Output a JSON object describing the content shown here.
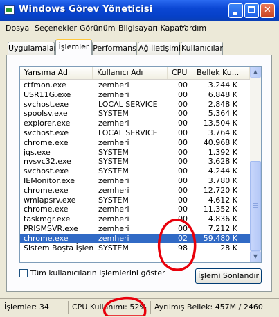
{
  "window": {
    "title": "Windows Görev Yöneticisi"
  },
  "menu": [
    "Dosya",
    "Seçenekler",
    "Görünüm",
    "Bilgisayarı Kapat",
    "Yardım"
  ],
  "tabs": [
    "Uygulamalar",
    "İşlemler",
    "Performans",
    "Ağ İletişimi",
    "Kullanıcılar"
  ],
  "active_tab": "İşlemler",
  "columns": [
    "Yansıma Adı",
    "Kullanıcı Adı",
    "CPU",
    "Bellek Ku..."
  ],
  "processes": [
    {
      "name": "ctfmon.exe",
      "user": "zemheri",
      "cpu": "00",
      "mem": "3.244 K"
    },
    {
      "name": "USR11G.exe",
      "user": "zemheri",
      "cpu": "00",
      "mem": "6.848 K"
    },
    {
      "name": "svchost.exe",
      "user": "LOCAL SERVICE",
      "cpu": "00",
      "mem": "2.848 K"
    },
    {
      "name": "spoolsv.exe",
      "user": "SYSTEM",
      "cpu": "00",
      "mem": "5.364 K"
    },
    {
      "name": "explorer.exe",
      "user": "zemheri",
      "cpu": "00",
      "mem": "13.504 K"
    },
    {
      "name": "svchost.exe",
      "user": "LOCAL SERVICE",
      "cpu": "00",
      "mem": "3.764 K"
    },
    {
      "name": "chrome.exe",
      "user": "zemheri",
      "cpu": "00",
      "mem": "40.968 K"
    },
    {
      "name": "jqs.exe",
      "user": "SYSTEM",
      "cpu": "00",
      "mem": "1.392 K"
    },
    {
      "name": "nvsvc32.exe",
      "user": "SYSTEM",
      "cpu": "00",
      "mem": "3.628 K"
    },
    {
      "name": "svchost.exe",
      "user": "SYSTEM",
      "cpu": "00",
      "mem": "4.244 K"
    },
    {
      "name": "IEMonitor.exe",
      "user": "zemheri",
      "cpu": "00",
      "mem": "3.780 K"
    },
    {
      "name": "chrome.exe",
      "user": "zemheri",
      "cpu": "00",
      "mem": "12.720 K"
    },
    {
      "name": "wmiapsrv.exe",
      "user": "SYSTEM",
      "cpu": "00",
      "mem": "4.612 K"
    },
    {
      "name": "chrome.exe",
      "user": "zemheri",
      "cpu": "00",
      "mem": "11.352 K"
    },
    {
      "name": "taskmgr.exe",
      "user": "zemheri",
      "cpu": "00",
      "mem": "4.836 K"
    },
    {
      "name": "PRISMSVR.exe",
      "user": "zemheri",
      "cpu": "00",
      "mem": "7.212 K"
    },
    {
      "name": "chrome.exe",
      "user": "zemheri",
      "cpu": "02",
      "mem": "59.480 K",
      "selected": true
    },
    {
      "name": "Sistem Boşta İşlemi",
      "user": "SYSTEM",
      "cpu": "98",
      "mem": "28 K"
    }
  ],
  "show_all_label": "Tüm kullanıcıların işlemlerini göster",
  "end_process_label": "İşlemi Sonlandır",
  "status": {
    "processes": "İşlemler: 34",
    "cpu": "CPU Kullanımı: 52%",
    "memory": "Ayrılmış Bellek: 457M / 2460"
  },
  "colors": {
    "titlebar": "#0a47d4",
    "selection": "#316ac5",
    "annotation": "#e8000b"
  }
}
